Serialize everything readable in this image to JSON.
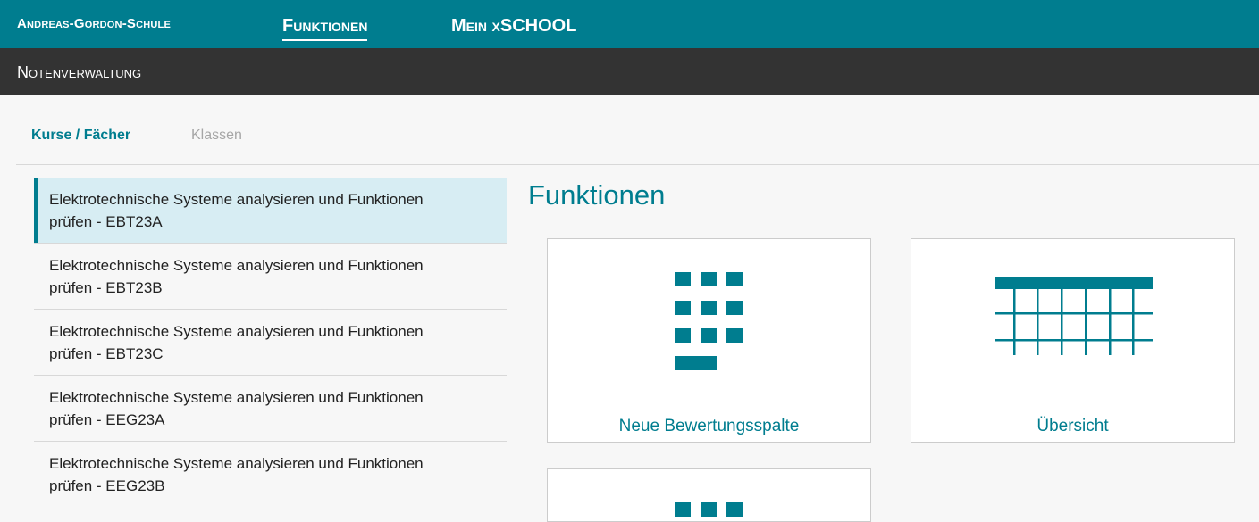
{
  "topbar": {
    "school": "Andreas-Gordon-Schule",
    "nav": [
      {
        "label": "Funktionen",
        "active": true
      },
      {
        "label": "Mein xSCHOOL",
        "active": false
      }
    ]
  },
  "subbar": {
    "title": "Notenverwaltung"
  },
  "tabs": [
    {
      "label": "Kurse / Fächer",
      "active": true
    },
    {
      "label": "Klassen",
      "active": false
    }
  ],
  "courses": [
    {
      "line1": "Elektrotechnische Systeme analysieren und Funktionen",
      "line2": "prüfen - EBT23A",
      "selected": true
    },
    {
      "line1": "Elektrotechnische Systeme analysieren und Funktionen",
      "line2": "prüfen - EBT23B",
      "selected": false
    },
    {
      "line1": "Elektrotechnische Systeme analysieren und Funktionen",
      "line2": "prüfen - EBT23C",
      "selected": false
    },
    {
      "line1": "Elektrotechnische Systeme analysieren und Funktionen",
      "line2": "prüfen - EEG23A",
      "selected": false
    },
    {
      "line1": "Elektrotechnische Systeme analysieren und Funktionen",
      "line2": "prüfen - EEG23B",
      "selected": false
    }
  ],
  "functions": {
    "title": "Funktionen",
    "cards": [
      {
        "label": "Neue Bewertungsspalte",
        "icon": "keypad-icon"
      },
      {
        "label": "Übersicht",
        "icon": "table-grid-icon"
      },
      {
        "label": "",
        "icon": "keypad-icon"
      }
    ]
  },
  "colors": {
    "accent": "#007d8f",
    "subbar": "#333333",
    "selected_bg": "#d7edf3"
  }
}
